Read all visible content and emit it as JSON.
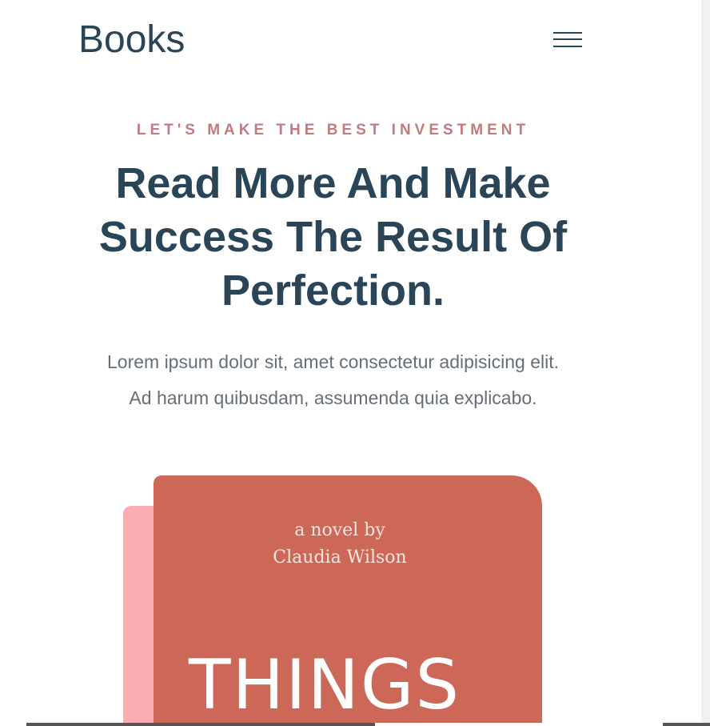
{
  "header": {
    "brand": "Books",
    "menu_icon": "hamburger-menu-icon"
  },
  "hero": {
    "eyebrow": "LET'S MAKE THE BEST INVESTMENT",
    "headline": "Read More And Make Success The Result Of Perfection.",
    "lead_line1": "Lorem ipsum dolor sit, amet consectetur adipisicing elit.",
    "lead_line2": "Ad harum quibusdam, assumenda quia explicabo."
  },
  "book_cover": {
    "byline_line1": "a novel by",
    "byline_line2": "Claudia Wilson",
    "title": "THINGS"
  },
  "colors": {
    "primary": "#2b4558",
    "accent": "#c27b7f",
    "cover": "#cd6858",
    "cover_back": "#fbaeb1"
  }
}
